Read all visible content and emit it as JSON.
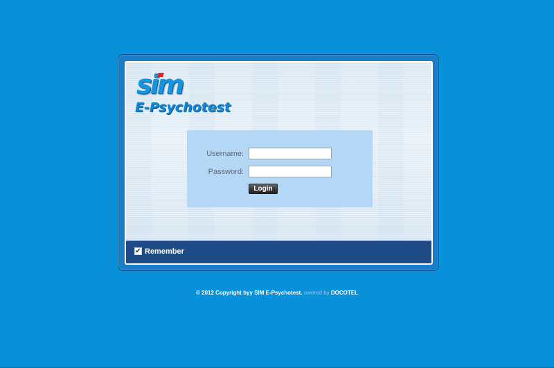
{
  "logo": {
    "brand": "sim",
    "subtitle": "E-Psychotest"
  },
  "login_form": {
    "username_label": "Username:",
    "username_value": "",
    "password_label": "Password:",
    "password_value": "",
    "login_button": "Login"
  },
  "footer_bar": {
    "remember_label": "Remember",
    "remember_checked": true,
    "check_glyph": "✔"
  },
  "copyright": {
    "main": "© 2012 Copyright byy SIM E-Psychotest.",
    "powered_prefix": "owered by",
    "company": "DOCOTEL"
  },
  "colors": {
    "background": "#0890d9",
    "footer_bar": "#1e4a85",
    "form_box": "#b3d7f4",
    "logo_blue": "#1794dc",
    "logo_red": "#e3232a"
  }
}
